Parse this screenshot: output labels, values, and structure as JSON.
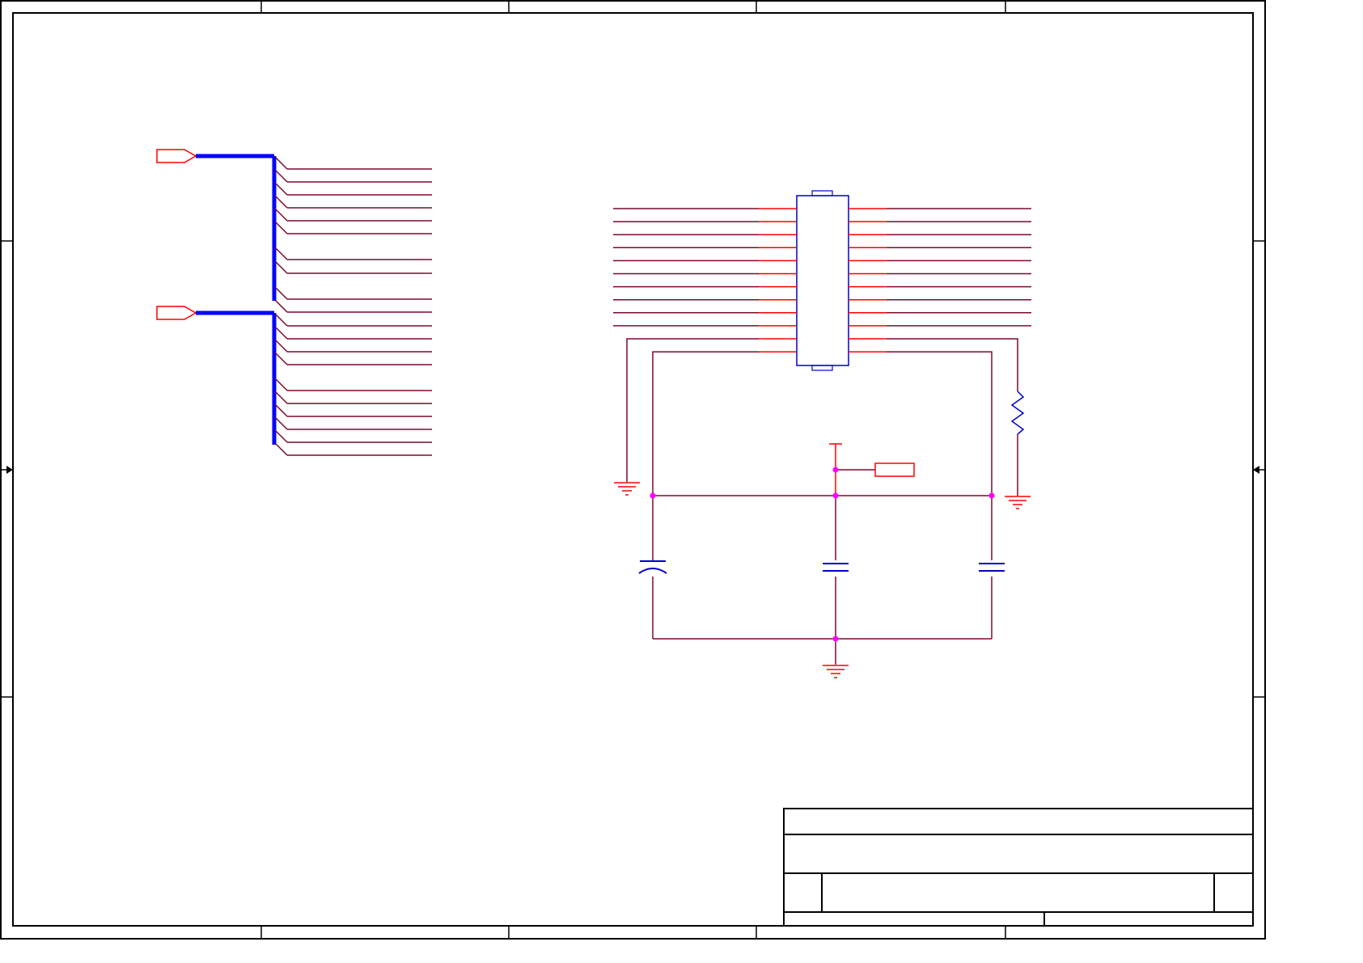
{
  "sheet": {
    "title_block_text": "",
    "colors": {
      "frame": "#000000",
      "wire": "#7a0a2a",
      "pin": "#ff0000",
      "bus": "#0000ff",
      "component": "#0000cc",
      "junction": "#ff00ff",
      "port": "#ff0000"
    }
  },
  "bus_groups": [
    {
      "name": "",
      "entries": 10,
      "gaps_after": [
        5,
        6
      ]
    },
    {
      "name": "",
      "entries": 11,
      "gaps_after": [
        4
      ]
    }
  ],
  "ic": {
    "pins_per_side": 12
  },
  "passives": [
    {
      "type": "polarized-capacitor"
    },
    {
      "type": "capacitor"
    },
    {
      "type": "capacitor"
    },
    {
      "type": "resistor"
    }
  ]
}
